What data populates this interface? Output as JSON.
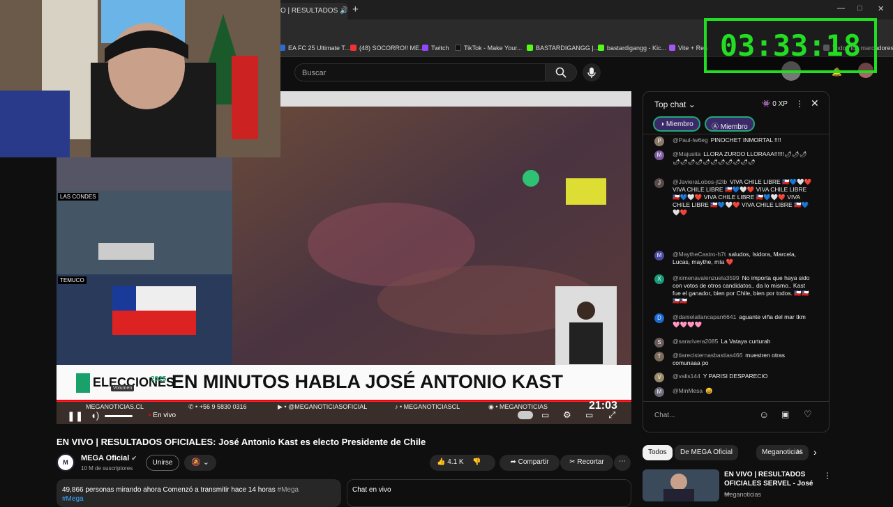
{
  "browser": {
    "tab_title": "O | RESULTADOS",
    "new_tab": "+",
    "window_controls": [
      "—",
      "□",
      "✕"
    ],
    "bookmarks": [
      "EA FC 25 Ultimate T...",
      "(48) SOCORRO!! ME...",
      "Twitch",
      "TikTok - Make Your...",
      "BASTARDIGANGG |...",
      "bastardigangg - Kic...",
      "Vite + Rea",
      "Todos los marcadores"
    ]
  },
  "youtube": {
    "search_placeholder": "Buscar"
  },
  "stream_timer": "03:33:18",
  "video": {
    "banner_logo": "ELECCIONES",
    "banner_year": "2025",
    "headline": "EN MINUTOS HABLA JOSÉ ANTONIO KAST",
    "location_1": "LAS CONDES",
    "location_2": "TEMUCO",
    "ticker": [
      "MEGANOTICIAS.CL",
      "+56 9 5830 0316",
      "@MEGANOTICIASOFICIAL",
      "MEGANOTICIASCL",
      "MEGANOTICIAS"
    ],
    "clock": "21:03",
    "live_label": "En vivo",
    "tooltip": "Volumen"
  },
  "title": "EN VIVO | RESULTADOS OFICIALES: José Antonio Kast es electo Presidente de Chile",
  "channel": {
    "name": "MEGA Oficial",
    "subscribers": "10 M de suscriptores",
    "join_label": "Unirse",
    "likes": "4.1 K",
    "share_label": "Compartir",
    "clip_label": "Recortar"
  },
  "description": {
    "stats": "49,866 personas mirando ahora  Comenzó a transmitir hace 14 horas",
    "hashtag": "#Mega",
    "hashtag2": "#Mega"
  },
  "live_chat_section": "Chat en vivo",
  "chat": {
    "header": "Top chat",
    "xp": "0 XP",
    "filter_1": "Miembro",
    "filter_2": "Miembro",
    "input_placeholder": "Chat...",
    "messages": [
      {
        "author": "@Paul-lw6eg",
        "text": "PINOCHET INMORTAL !!!!",
        "avatar": "P",
        "color": "#8a7a6a"
      },
      {
        "author": "@Majusita",
        "text": "LLORA ZURDO LLORAAA!!!!!!🌶🌶🌶🌶🌶🌶🌶🌶🌶🌶🌶🌶🌶🌶",
        "avatar": "M",
        "color": "#7a5a9a"
      },
      {
        "author": "@JavieraLobos-jt2tb",
        "text": "VIVA CHILE LIBRE 🇨🇱💙🤍❤️ VIVA CHILE LIBRE 🇨🇱💙🤍❤️ VIVA CHILE LIBRE 🇨🇱💙🤍❤️ VIVA CHILE LIBRE 🇨🇱💙🤍❤️ VIVA CHILE LIBRE 🇨🇱💙🤍❤️ VIVA CHILE LIBRE 🇨🇱💙🤍❤️",
        "avatar": "J",
        "color": "#5a4a4a"
      },
      {
        "author": "@MaytheCastro-h7t",
        "text": "saludos, Isidora, Marcela, Lucas, maythe, mía ❤️",
        "avatar": "M",
        "color": "#4a4aa0"
      },
      {
        "author": "@ximenavalenzuela3599",
        "text": "No importa que haya sido con votos de otros candidatos.. da lo mismo.. Kast fue el ganador, bien por Chile, bien por todos. 🇨🇱🇨🇱🇨🇱🇨🇱",
        "avatar": "X",
        "color": "#1a9a7a"
      },
      {
        "author": "@danielallancapan6641",
        "text": "aguante viña del mar tkm 🩷🩷🩷🩷",
        "avatar": "D",
        "color": "#1a6ad0"
      },
      {
        "author": "@sararivera2085",
        "text": "La Vataya curturah",
        "avatar": "S",
        "color": "#6a5a5a"
      },
      {
        "author": "@tiarecisternasbastias466",
        "text": "muestren otras comunaaa po",
        "avatar": "T",
        "color": "#7a6a5a"
      },
      {
        "author": "@valis144",
        "text": "Y PARISI DESPARECIO",
        "avatar": "V",
        "color": "#9a8a6a"
      },
      {
        "author": "@MinMesa",
        "text": "😄",
        "avatar": "M",
        "color": "#6a6a7a"
      }
    ]
  },
  "recs": {
    "chips": [
      "Todos",
      "De MEGA Oficial",
      "Meganoticias",
      "N"
    ],
    "video_title": "EN VIVO | RESULTADOS OFICIALES SERVEL - José ...",
    "video_channel": "Meganoticias"
  }
}
